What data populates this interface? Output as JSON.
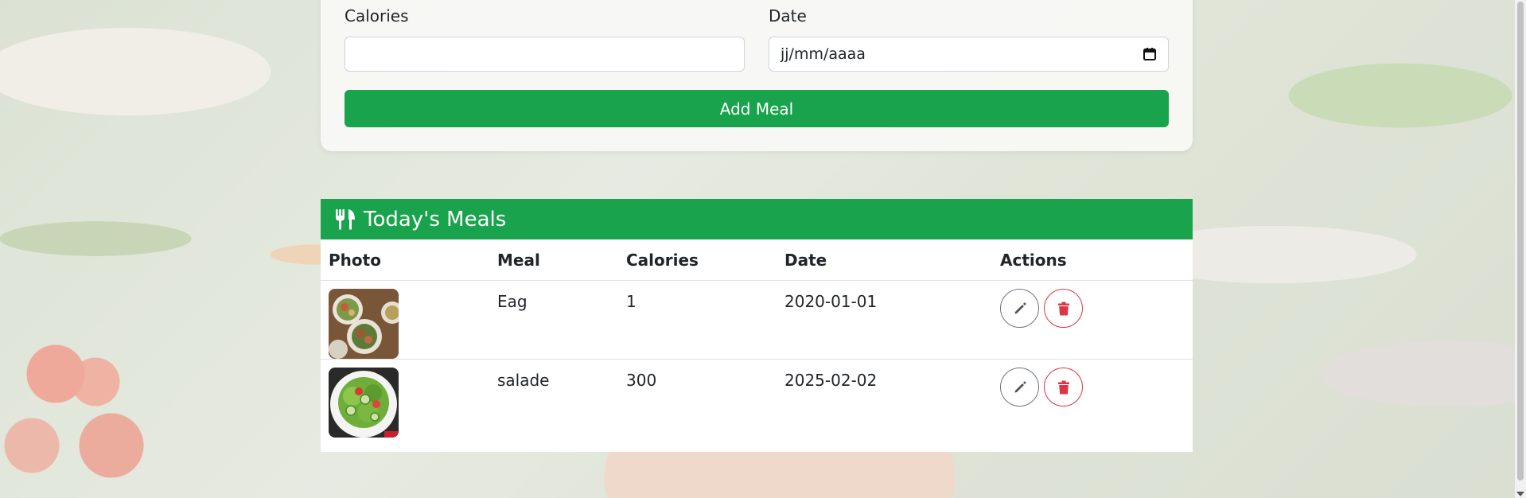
{
  "form": {
    "calories_label": "Calories",
    "calories_value": "",
    "date_label": "Date",
    "date_placeholder": "jj/mm/aaaa",
    "add_button": "Add Meal"
  },
  "meals": {
    "title": "Today's Meals",
    "columns": [
      "Photo",
      "Meal",
      "Calories",
      "Date",
      "Actions"
    ],
    "rows": [
      {
        "meal": "Eag",
        "calories": "1",
        "date": "2020-01-01"
      },
      {
        "meal": "salade",
        "calories": "300",
        "date": "2025-02-02"
      }
    ]
  },
  "colors": {
    "primary": "#19a34c",
    "danger": "#dc3545",
    "secondary": "#6c757d"
  },
  "icons": {
    "header": "utensils-icon",
    "edit": "pencil-icon",
    "delete": "trash-icon",
    "date_picker": "calendar-icon"
  }
}
